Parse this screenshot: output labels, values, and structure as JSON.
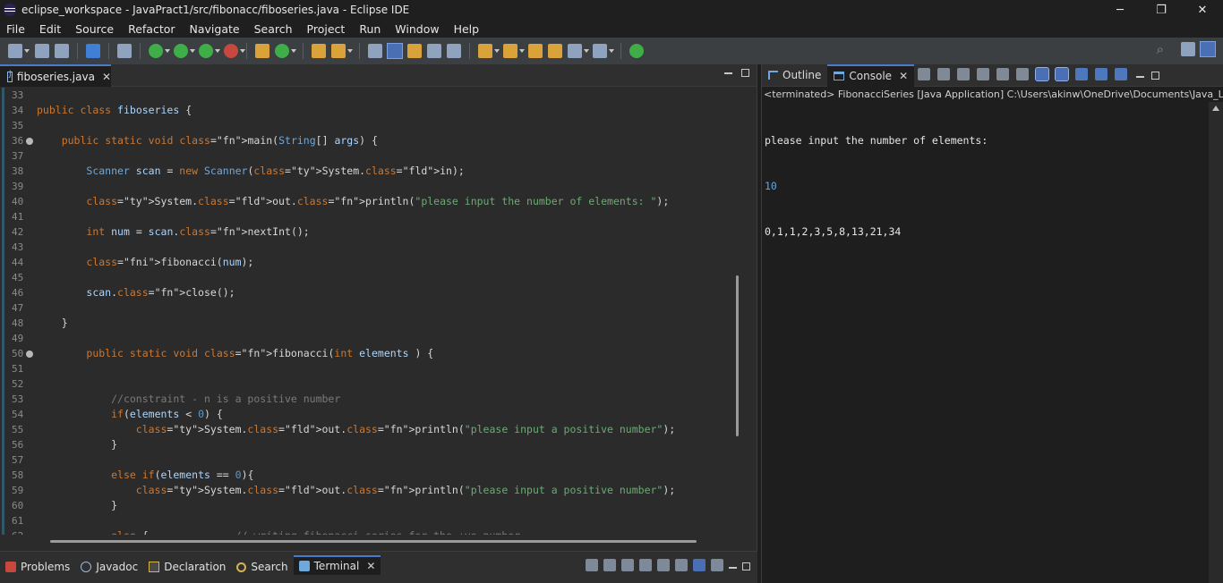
{
  "window": {
    "title": "eclipse_workspace - JavaPract1/src/fibonacc/fiboseries.java - Eclipse IDE",
    "minimize": "─",
    "restore": "❐",
    "close": "✕"
  },
  "menu": [
    "File",
    "Edit",
    "Source",
    "Refactor",
    "Navigate",
    "Search",
    "Project",
    "Run",
    "Window",
    "Help"
  ],
  "editor": {
    "tab_label": "fiboseries.java",
    "close_glyph": "✕",
    "lines": [
      {
        "n": "33",
        "t": ""
      },
      {
        "n": "34",
        "t": "public class fiboseries {"
      },
      {
        "n": "35",
        "t": ""
      },
      {
        "n": "36",
        "t": "    public static void main(String[] args) {"
      },
      {
        "n": "37",
        "t": ""
      },
      {
        "n": "38",
        "t": "        Scanner scan = new Scanner(System.in);"
      },
      {
        "n": "39",
        "t": ""
      },
      {
        "n": "40",
        "t": "        System.out.println(\"please input the number of elements: \");"
      },
      {
        "n": "41",
        "t": ""
      },
      {
        "n": "42",
        "t": "        int num = scan.nextInt();"
      },
      {
        "n": "43",
        "t": ""
      },
      {
        "n": "44",
        "t": "        fibonacci(num);"
      },
      {
        "n": "45",
        "t": ""
      },
      {
        "n": "46",
        "t": "        scan.close();"
      },
      {
        "n": "47",
        "t": ""
      },
      {
        "n": "48",
        "t": "    }"
      },
      {
        "n": "49",
        "t": ""
      },
      {
        "n": "50",
        "t": "        public static void fibonacci(int elements ) {"
      },
      {
        "n": "51",
        "t": ""
      },
      {
        "n": "52",
        "t": ""
      },
      {
        "n": "53",
        "t": "            //constraint - n is a positive number"
      },
      {
        "n": "54",
        "t": "            if(elements < 0) {"
      },
      {
        "n": "55",
        "t": "                System.out.println(\"please input a positive number\");"
      },
      {
        "n": "56",
        "t": "            }"
      },
      {
        "n": "57",
        "t": ""
      },
      {
        "n": "58",
        "t": "            else if(elements == 0){"
      },
      {
        "n": "59",
        "t": "                System.out.println(\"please input a positive number\");"
      },
      {
        "n": "60",
        "t": "            }"
      },
      {
        "n": "61",
        "t": ""
      },
      {
        "n": "62",
        "t": "            else {              // writing fibonacci series for the +ve number"
      }
    ]
  },
  "console": {
    "outline_label": "Outline",
    "console_label": "Console",
    "status": "<terminated> FibonacciSeries [Java Application] C:\\Users\\akinw\\OneDrive\\Documents\\Java_LabEx",
    "output": [
      "please input the number of elements:",
      "10",
      "0,1,1,2,3,5,8,13,21,34"
    ]
  },
  "bottom_views": [
    "Problems",
    "Javadoc",
    "Declaration",
    "Search",
    "Terminal"
  ],
  "colors": {
    "accent": "#4a7ac9",
    "keyword": "#cc7832",
    "string": "#6aab73",
    "input": "#5fa8e8"
  }
}
